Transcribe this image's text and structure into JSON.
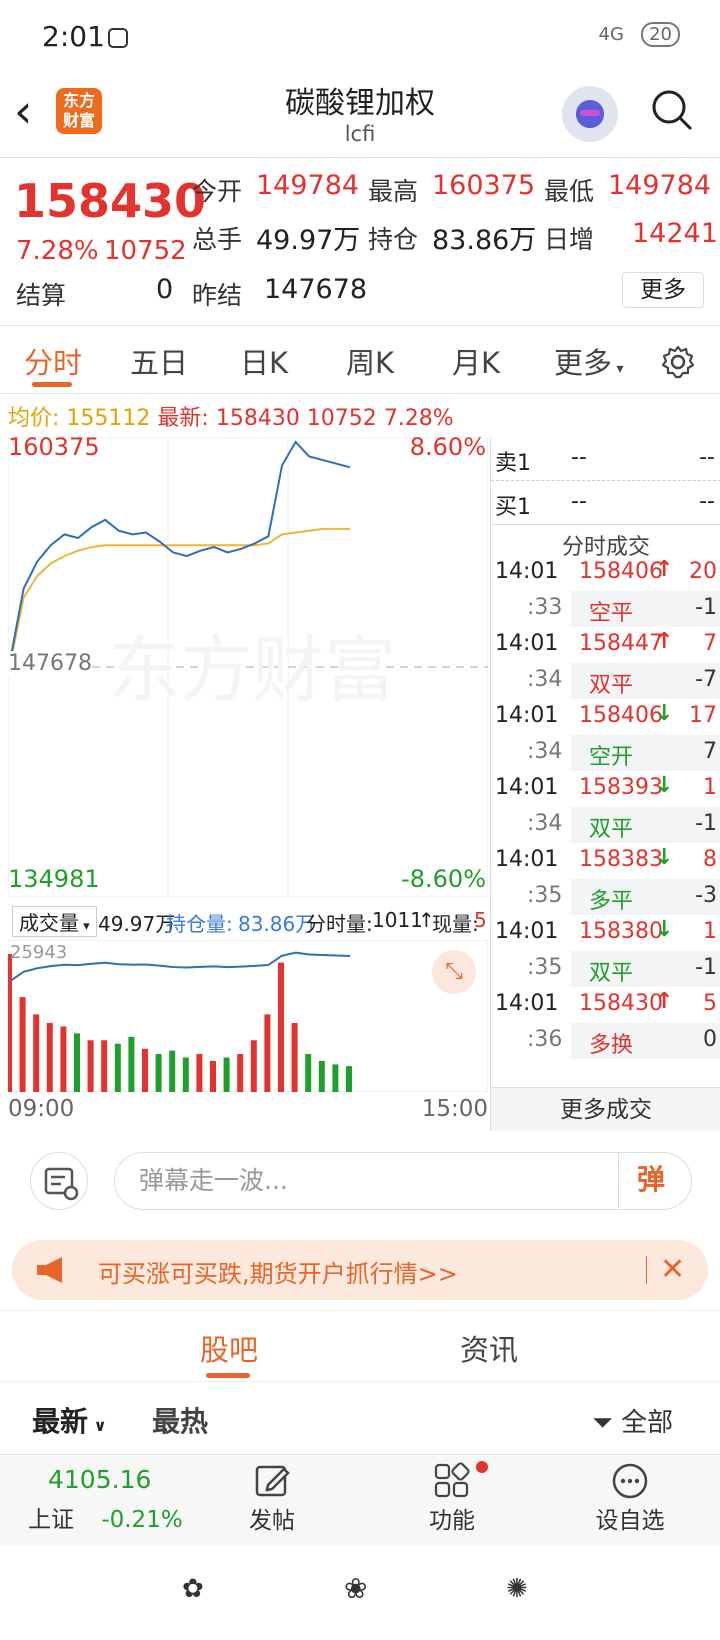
{
  "status": {
    "time": "2:01",
    "network": "4G",
    "battery": "20"
  },
  "header": {
    "title": "碳酸锂加权",
    "subtitle": "lcfi",
    "logo_text": "东方财富"
  },
  "quote": {
    "last": "158430",
    "pct": "7.28%",
    "change": "10752",
    "open_label": "今开",
    "open": "149784",
    "high_label": "最高",
    "high": "160375",
    "low_label": "最低",
    "low": "149784",
    "volume_label": "总手",
    "volume": "49.97万",
    "oi_label": "持仓",
    "oi": "83.86万",
    "daily_inc_label": "日增",
    "daily_inc": "14241",
    "settle_label": "结算",
    "settle": "0",
    "prev_settle_label": "昨结",
    "prev_settle": "147678",
    "more_label": "更多"
  },
  "tabs": [
    "分时",
    "五日",
    "日K",
    "周K",
    "月K",
    "更多"
  ],
  "avgline": {
    "avg_label": "均价:",
    "avg": "155112",
    "last_label": "最新:",
    "last": "158430",
    "chg": "10752",
    "pct": "7.28%"
  },
  "chart_data": {
    "type": "line",
    "x": [
      "09:00",
      "15:00"
    ],
    "ylim": [
      134981,
      160375
    ],
    "upper_label": "160375",
    "lower_label": "134981",
    "mid_label": "147678",
    "upper_pct": "8.60%",
    "lower_pct": "-8.60%",
    "watermark": "东方财富",
    "price_series": [
      148000,
      152000,
      153500,
      154400,
      155000,
      154800,
      155400,
      155800,
      155200,
      155000,
      155100,
      154600,
      154000,
      153800,
      154100,
      154300,
      154000,
      154200,
      154500,
      154900,
      158800,
      160100,
      159300,
      159100,
      158900,
      158700
    ],
    "avg_series": [
      147800,
      151500,
      152700,
      153400,
      153800,
      154100,
      154300,
      154400,
      154400,
      154400,
      154400,
      154400,
      154400,
      154400,
      154400,
      154400,
      154400,
      154400,
      154400,
      154500,
      155000,
      155100,
      155200,
      155300,
      155300,
      155300
    ],
    "volume_series": [
      80,
      55,
      45,
      40,
      38,
      34,
      30,
      30,
      28,
      32,
      25,
      22,
      24,
      20,
      22,
      18,
      20,
      22,
      30,
      45,
      75,
      40,
      22,
      18,
      16,
      15
    ]
  },
  "volume_head": {
    "selector": "成交量",
    "volume": "49.97万",
    "oi_label": "持仓量:",
    "oi": "83.86万",
    "tick_label": "分时量:",
    "tick": "1011",
    "now_label": "现量:",
    "now": "5",
    "vol_top": "25943"
  },
  "time_axis": {
    "start": "09:00",
    "end": "15:00"
  },
  "book": {
    "ask_label": "卖1",
    "ask_price": "--",
    "ask_vol": "--",
    "bid_label": "买1",
    "bid_price": "--",
    "bid_vol": "--",
    "trades_title": "分时成交",
    "trades": [
      {
        "time": "14:01",
        "sec": ":33",
        "price": "158406",
        "dir": "↑",
        "vol": "20",
        "type": "空平",
        "delta": "-1",
        "dir_color": "#e3332e",
        "type_color": "#e3332e"
      },
      {
        "time": "14:01",
        "sec": ":34",
        "price": "158447",
        "dir": "↑",
        "vol": "7",
        "type": "双平",
        "delta": "-7",
        "dir_color": "#e3332e",
        "type_color": "#e3332e"
      },
      {
        "time": "14:01",
        "sec": ":34",
        "price": "158406",
        "dir": "↓",
        "vol": "17",
        "type": "空开",
        "delta": "7",
        "dir_color": "#1ea02a",
        "type_color": "#1ea02a"
      },
      {
        "time": "14:01",
        "sec": ":34",
        "price": "158393",
        "dir": "↓",
        "vol": "1",
        "type": "双平",
        "delta": "-1",
        "dir_color": "#1ea02a",
        "type_color": "#1ea02a"
      },
      {
        "time": "14:01",
        "sec": ":35",
        "price": "158383",
        "dir": "↓",
        "vol": "8",
        "type": "多平",
        "delta": "-3",
        "dir_color": "#1ea02a",
        "type_color": "#1ea02a"
      },
      {
        "time": "14:01",
        "sec": ":35",
        "price": "158380",
        "dir": "↓",
        "vol": "1",
        "type": "双平",
        "delta": "-1",
        "dir_color": "#1ea02a",
        "type_color": "#1ea02a"
      },
      {
        "time": "14:01",
        "sec": ":36",
        "price": "158430",
        "dir": "↑",
        "vol": "5",
        "type": "多换",
        "delta": "0",
        "dir_color": "#e3332e",
        "type_color": "#e3332e"
      }
    ],
    "more_trades": "更多成交"
  },
  "danmu": {
    "placeholder": "弹幕走一波...",
    "send": "弹"
  },
  "promo": {
    "text": "可买涨可买跌,期货开户抓行情>>"
  },
  "community": {
    "tabs": [
      "股吧",
      "资讯"
    ],
    "sort_latest": "最新",
    "sort_hot": "最热",
    "filter": "全部"
  },
  "bottom": {
    "index_value": "4105.16",
    "index_name": "上证",
    "index_pct": "-0.21%",
    "post": "发帖",
    "func": "功能",
    "watch": "设自选"
  }
}
